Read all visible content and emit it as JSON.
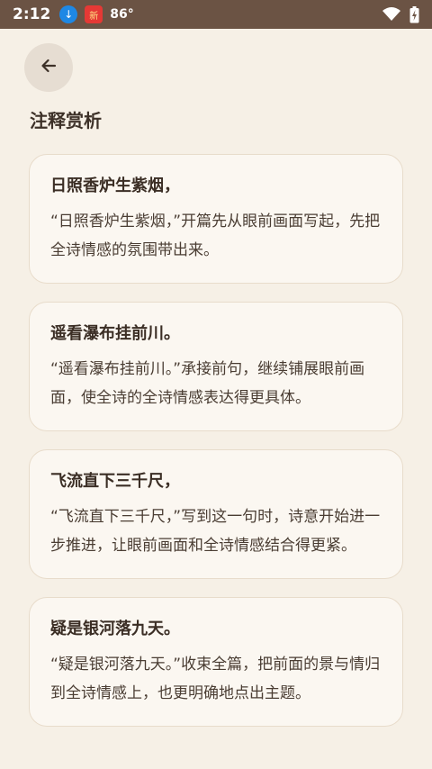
{
  "status": {
    "time": "2:12",
    "temperature": "86°",
    "app_icon_text": "新"
  },
  "header": {
    "title": "注释赏析"
  },
  "cards": [
    {
      "title": "日照香炉生紫烟，",
      "text": "“日照香炉生紫烟，”开篇先从眼前画面写起，先把全诗情感的氛围带出来。"
    },
    {
      "title": "遥看瀑布挂前川。",
      "text": "“遥看瀑布挂前川。”承接前句，继续铺展眼前画面，使全诗的全诗情感表达得更具体。"
    },
    {
      "title": "飞流直下三千尺，",
      "text": "“飞流直下三千尺，”写到这一句时，诗意开始进一步推进，让眼前画面和全诗情感结合得更紧。"
    },
    {
      "title": "疑是银河落九天。",
      "text": "“疑是银河落九天。”收束全篇，把前面的景与情归到全诗情感上，也更明确地点出主题。"
    }
  ]
}
